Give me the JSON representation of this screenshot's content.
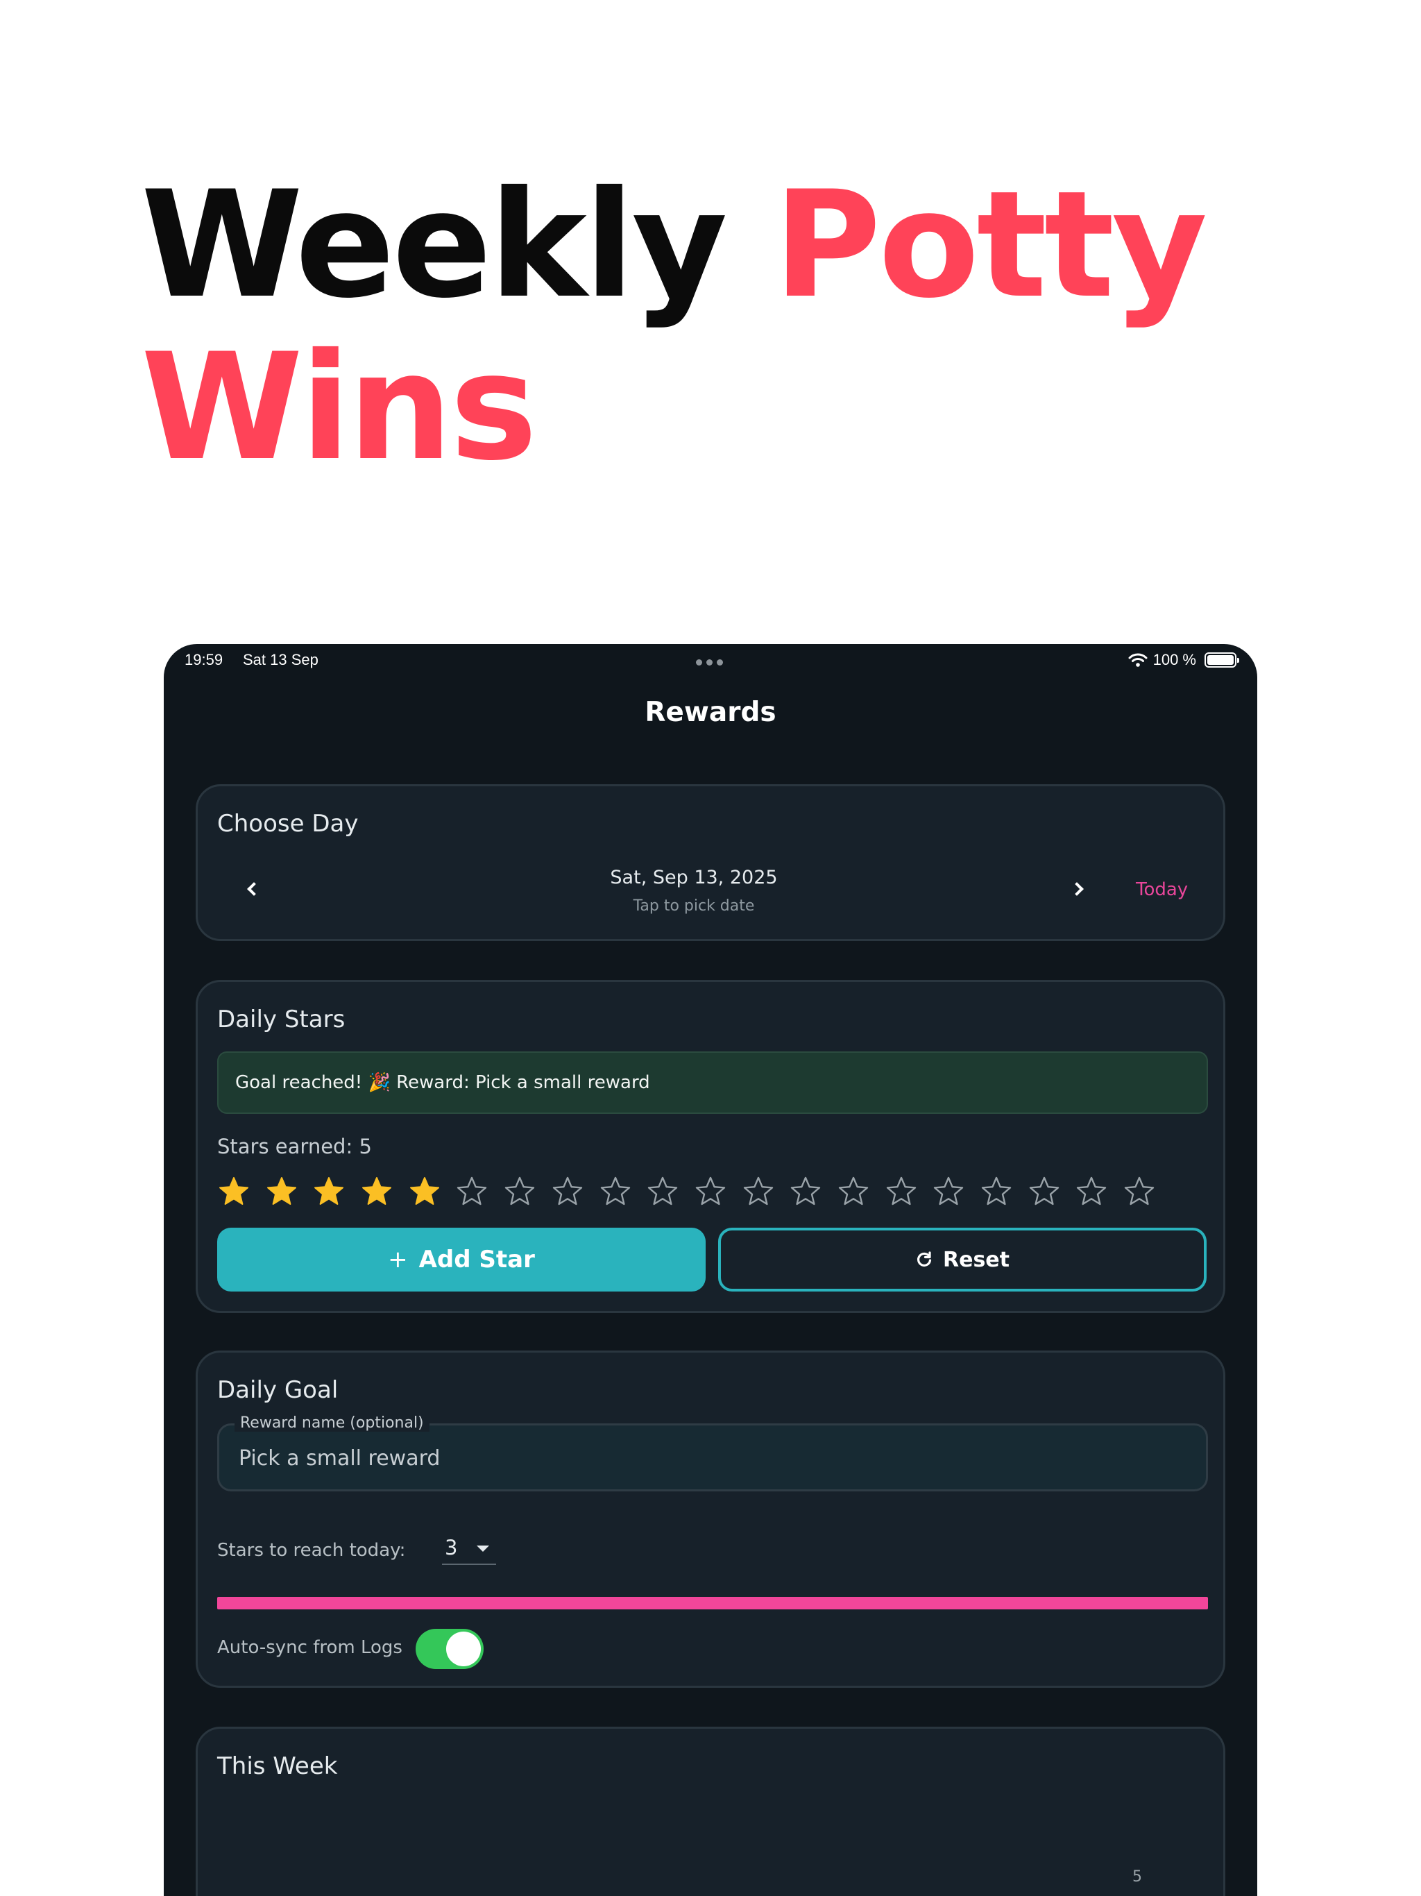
{
  "headline": {
    "line1_dark": "Weekly",
    "line1_accent": "Potty",
    "line2_accent": "Wins"
  },
  "colors": {
    "accent_red": "#ff4358",
    "teal": "#2ab3bd",
    "pink": "#f2469a",
    "green": "#34c759",
    "star_gold": "#fbbf24"
  },
  "status_bar": {
    "time": "19:59",
    "date": "Sat 13 Sep",
    "battery": "100 %"
  },
  "nav": {
    "title": "Rewards"
  },
  "choose_day": {
    "title": "Choose Day",
    "date": "Sat, Sep 13, 2025",
    "hint": "Tap to pick date",
    "today_label": "Today",
    "prev_icon": "chevron-left-icon",
    "next_icon": "chevron-right-icon"
  },
  "daily_stars": {
    "title": "Daily Stars",
    "goal_banner": "Goal reached! 🎉  Reward: Pick a small reward",
    "stars_earned_text": "Stars earned: 5",
    "stars_earned": 5,
    "stars_total": 20,
    "add_label": "Add Star",
    "reset_label": "Reset"
  },
  "daily_goal": {
    "title": "Daily Goal",
    "reward_label": "Reward name (optional)",
    "reward_value": "Pick a small reward",
    "reach_label": "Stars to reach today:",
    "reach_value": "3",
    "progress_fraction": 1.0,
    "sync_label": "Auto-sync from Logs",
    "sync_on": true
  },
  "this_week": {
    "title": "This Week",
    "chart_data": {
      "type": "line",
      "points": [
        {
          "value": 5,
          "label": "5"
        }
      ]
    }
  }
}
